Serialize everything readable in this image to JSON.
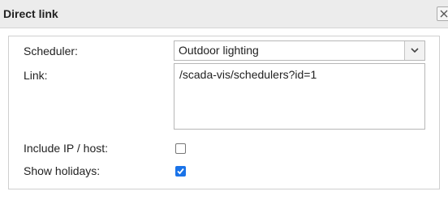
{
  "dialog": {
    "title": "Direct link",
    "close_icon": "close-icon"
  },
  "form": {
    "scheduler": {
      "label": "Scheduler:",
      "selected": "Outdoor lighting",
      "arrow_icon": "chevron-down-icon"
    },
    "link": {
      "label": "Link:",
      "value": "/scada-vis/schedulers?id=1"
    },
    "include_ip_host": {
      "label": "Include IP / host:",
      "checked": false
    },
    "show_holidays": {
      "label": "Show holidays:",
      "checked": true
    }
  },
  "colors": {
    "accent": "#1a73e8",
    "titlebar": "#ececec"
  }
}
